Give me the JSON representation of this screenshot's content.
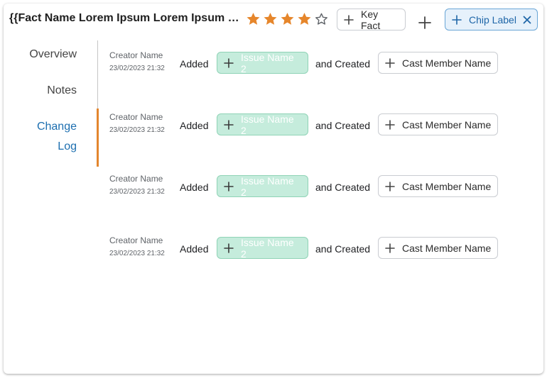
{
  "header": {
    "title": "{{Fact Name Lorem Ipsum Lorem Ipsum Lorem Ipsum Lorem Ipsum}}",
    "rating": 4,
    "rating_max": 5,
    "star_color": "#e6862b",
    "key_fact_label": "Key Fact",
    "add_icon": "plus-icon",
    "chip_label": "Chip Label",
    "chip_close_icon": "close-icon"
  },
  "nav": {
    "items": [
      {
        "label": "Overview",
        "active": false
      },
      {
        "label": "Notes",
        "active": false
      },
      {
        "label": "Change Log",
        "active": true
      }
    ],
    "active_color": "#e3862e"
  },
  "log": {
    "entries": [
      {
        "creator": "Creator Name",
        "date": "23/02/2023  21:32",
        "action": "Added",
        "issue": "Issue Name 2",
        "connector": "and Created",
        "cast": "Cast Member Name"
      },
      {
        "creator": "Creator Name",
        "date": "23/02/2023  21:32",
        "action": "Added",
        "issue": "Issue Name 2",
        "connector": "and Created",
        "cast": "Cast Member Name"
      },
      {
        "creator": "Creator Name",
        "date": "23/02/2023  21:32",
        "action": "Added",
        "issue": "Issue Name 2",
        "connector": "and Created",
        "cast": "Cast Member Name"
      },
      {
        "creator": "Creator Name",
        "date": "23/02/2023  21:32",
        "action": "Added",
        "issue": "Issue Name 2",
        "connector": "and Created",
        "cast": "Cast Member Name"
      }
    ]
  }
}
